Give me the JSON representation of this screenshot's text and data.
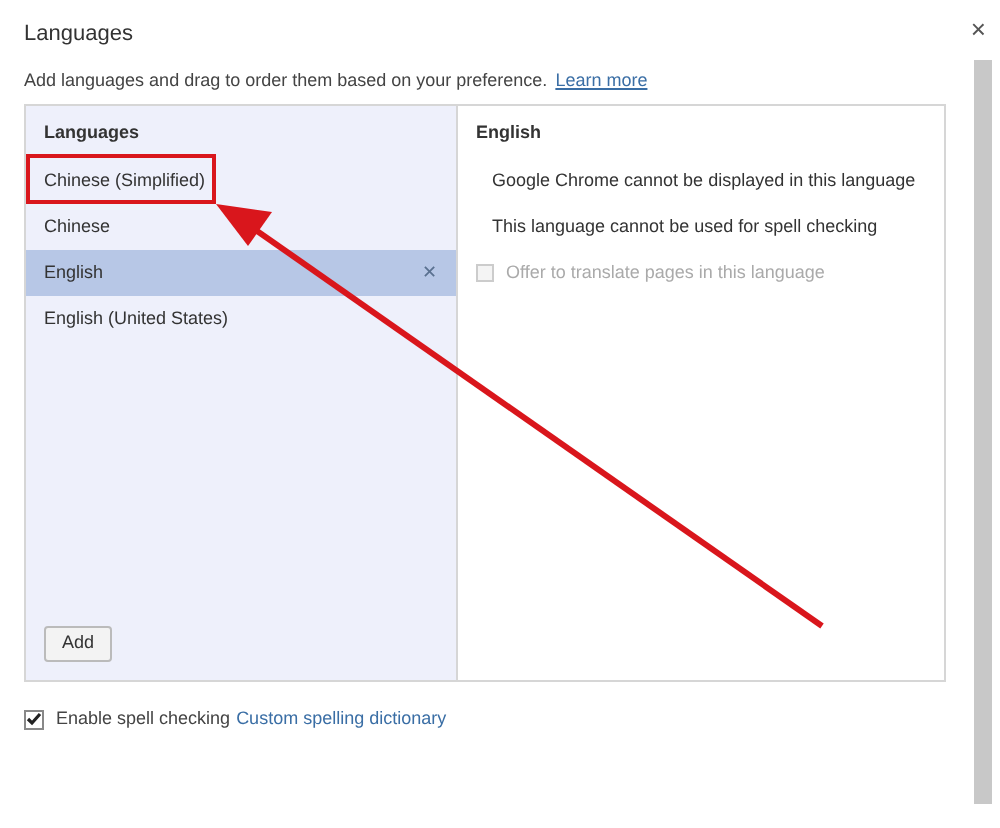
{
  "window": {
    "title": "Languages",
    "close": "×"
  },
  "description": {
    "text": "Add languages and drag to order them based on your preference.",
    "link": "Learn more"
  },
  "languages": {
    "heading": "Languages",
    "items": [
      {
        "label": "Chinese (Simplified)",
        "selected": false
      },
      {
        "label": "Chinese",
        "selected": false
      },
      {
        "label": "English",
        "selected": true,
        "remove": "✕"
      },
      {
        "label": "English (United States)",
        "selected": false
      }
    ],
    "add_button": "Add"
  },
  "details": {
    "heading": "English",
    "lines": [
      "Google Chrome cannot be displayed in this language",
      "This language cannot be used for spell checking"
    ],
    "translate": {
      "label": "Offer to translate pages in this language",
      "checked": false,
      "disabled": true
    }
  },
  "spell_check": {
    "label": "Enable spell checking",
    "checked": true,
    "link": "Custom spelling dictionary"
  }
}
